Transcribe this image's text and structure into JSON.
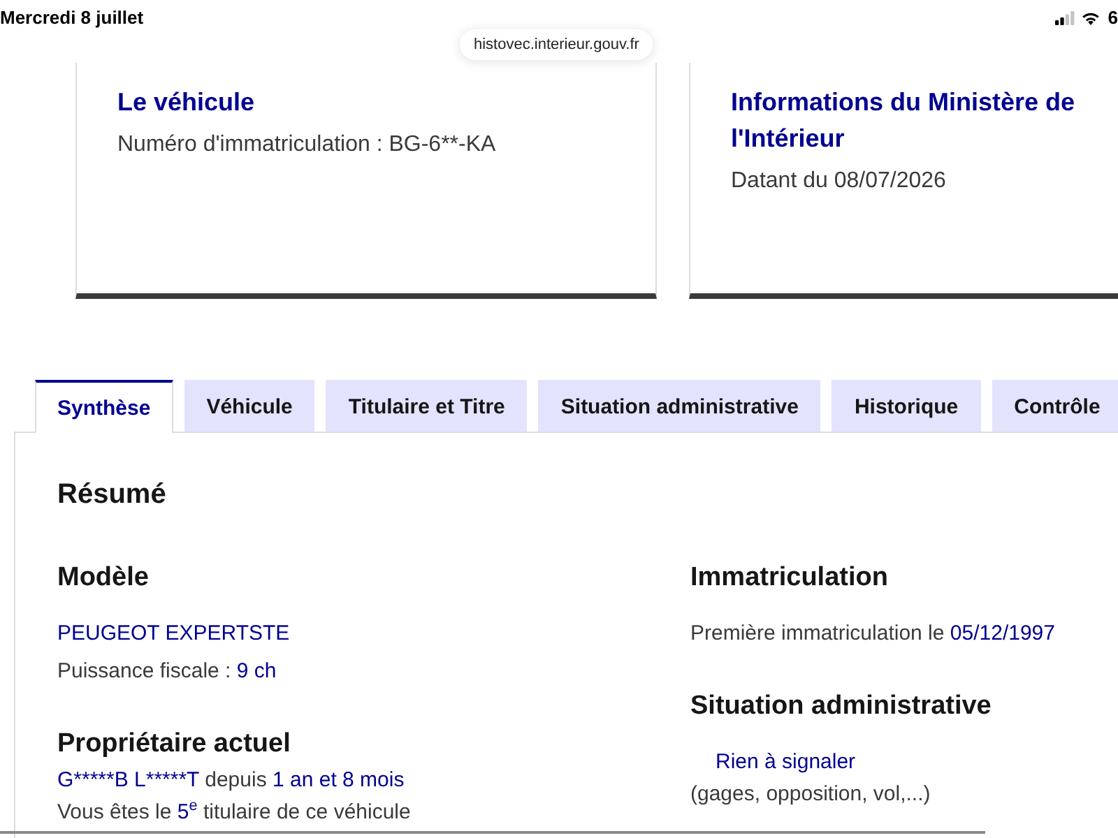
{
  "status_bar": {
    "date": "Mercredi 8 juillet",
    "battery": "6"
  },
  "address_bar": {
    "url": "histovec.interieur.gouv.fr"
  },
  "cards": [
    {
      "title": "Le véhicule",
      "text": "Numéro d'immatriculation : BG-6**-KA"
    },
    {
      "title": "Informations du Ministère de l'Intérieur",
      "text": "Datant du 08/07/2026"
    }
  ],
  "tabs": [
    {
      "label": "Synthèse",
      "selected": true
    },
    {
      "label": "Véhicule",
      "selected": false
    },
    {
      "label": "Titulaire et Titre",
      "selected": false
    },
    {
      "label": "Situation administrative",
      "selected": false
    },
    {
      "label": "Historique",
      "selected": false
    },
    {
      "label": "Contrôle",
      "selected": false
    }
  ],
  "summary": {
    "title": "Résumé",
    "columns": [
      {
        "sections": [
          {
            "heading": "Modèle",
            "lines": [
              {
                "kind": "text",
                "parts": [
                  {
                    "text": "PEUGEOT EXPERTSTE",
                    "highlight": true
                  }
                ]
              },
              {
                "kind": "text",
                "parts": [
                  {
                    "text": "Puissance fiscale :",
                    "highlight": false
                  },
                  {
                    "text": "9 ch",
                    "highlight": true
                  }
                ]
              }
            ]
          },
          {
            "heading": "Propriétaire actuel",
            "lines": [
              {
                "kind": "text",
                "parts": [
                  {
                    "text": "G*****B L*****T",
                    "highlight": true
                  },
                  {
                    "text": "depuis",
                    "highlight": false
                  },
                  {
                    "text": "1 an et 8 mois",
                    "highlight": true
                  }
                ]
              },
              {
                "kind": "text",
                "parts": [
                  {
                    "text": "Vous êtes le",
                    "highlight": false
                  },
                  {
                    "text": "5",
                    "superscript": "e",
                    "highlight": true
                  },
                  {
                    "text": "titulaire de ce véhicule",
                    "highlight": false
                  }
                ]
              }
            ]
          }
        ]
      },
      {
        "sections": [
          {
            "heading": "Immatriculation",
            "lines": [
              {
                "kind": "text",
                "parts": [
                  {
                    "text": "Première immatriculation le",
                    "highlight": false
                  },
                  {
                    "text": "05/12/1997",
                    "highlight": true
                  }
                ]
              }
            ]
          },
          {
            "heading": "Situation administrative",
            "lines": [
              {
                "kind": "status",
                "parts": [
                  {
                    "text": "Rien à signaler",
                    "highlight": true
                  }
                ]
              },
              {
                "kind": "text",
                "parts": [
                  {
                    "text": "(gages, opposition, vol,...)",
                    "highlight": false
                  }
                ]
              }
            ]
          }
        ]
      }
    ]
  }
}
